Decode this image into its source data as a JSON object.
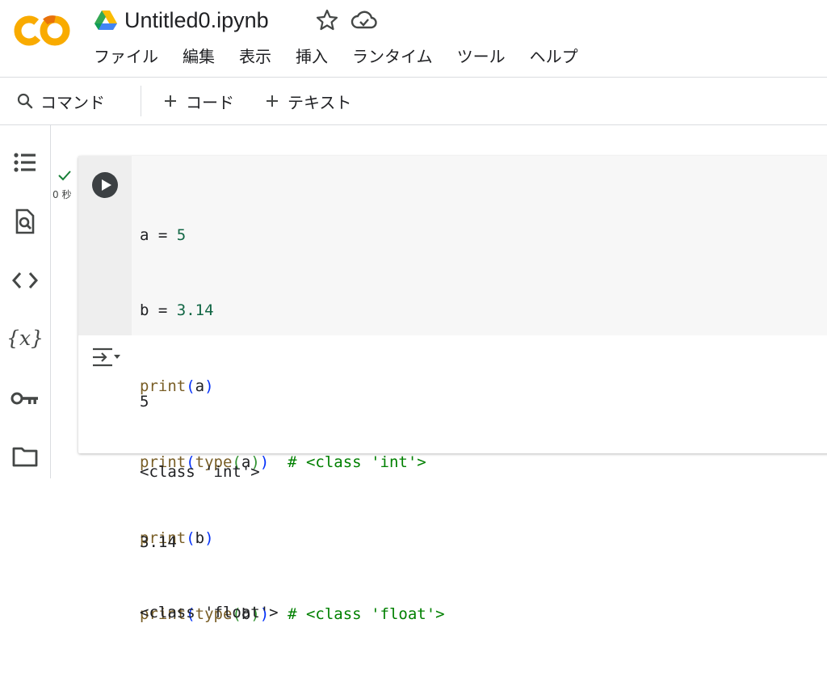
{
  "app": {
    "logo_text": "CO",
    "title": "Untitled0.ipynb"
  },
  "menu": [
    "ファイル",
    "編集",
    "表示",
    "挿入",
    "ランタイム",
    "ツール",
    "ヘルプ"
  ],
  "toolbar": {
    "command": "コマンド",
    "add_code": "コード",
    "add_text": "テキスト"
  },
  "sidebar": {
    "icons": [
      "table-of-contents-icon",
      "find-icon",
      "code-snippets-icon",
      "variables-icon",
      "secrets-key-icon",
      "files-folder-icon"
    ],
    "variables_label": "{x}"
  },
  "cell": {
    "exec_time": "0 秒",
    "status": "success",
    "code_lines": [
      "a = 5",
      "b = 3.14",
      "print(a)",
      "print(type(a))  # <class 'int'>",
      "print(b)",
      "print(type(b))  # <class 'float'>"
    ],
    "output_lines": [
      "5",
      "<class 'int'>",
      "3.14",
      "<class 'float'>"
    ]
  },
  "colors": {
    "logo_orange": "#F9AB00",
    "logo_orange_dark": "#E8710A",
    "number": "#116644",
    "function": "#795e26",
    "bracket_outer": "#0431fa",
    "bracket_inner": "#319331",
    "comment": "#008000",
    "check": "#188038"
  }
}
